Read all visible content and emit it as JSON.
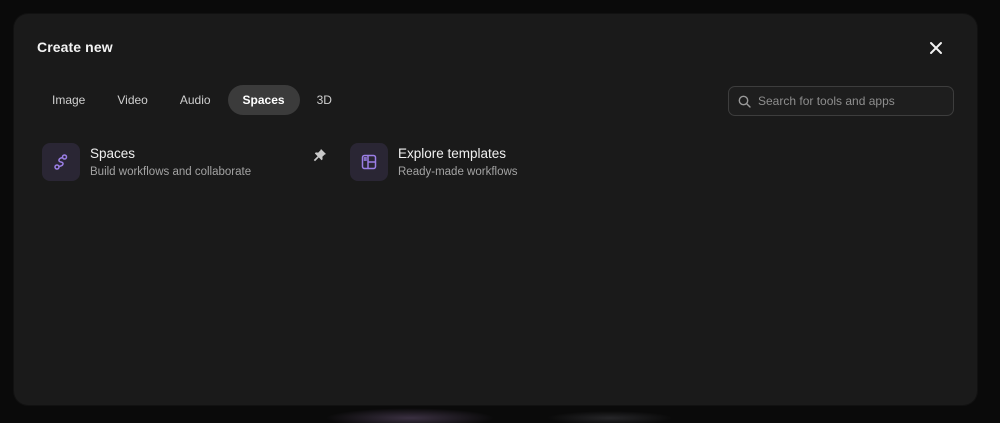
{
  "modal": {
    "title": "Create new",
    "close_icon": "close-icon"
  },
  "tabs": [
    {
      "label": "Image",
      "active": false
    },
    {
      "label": "Video",
      "active": false
    },
    {
      "label": "Audio",
      "active": false
    },
    {
      "label": "Spaces",
      "active": true
    },
    {
      "label": "3D",
      "active": false
    }
  ],
  "search": {
    "placeholder": "Search for tools and apps",
    "value": "",
    "icon": "search-icon"
  },
  "items": [
    {
      "title": "Spaces",
      "subtitle": "Build workflows and collaborate",
      "icon": "workflow-icon",
      "pinned": true
    },
    {
      "title": "Explore templates",
      "subtitle": "Ready-made workflows",
      "icon": "template-icon",
      "pinned": false
    }
  ],
  "colors": {
    "modal_bg": "#1a1a1a",
    "accent_purple": "#9b7fe6",
    "active_tab_bg": "#3b3b3b"
  }
}
